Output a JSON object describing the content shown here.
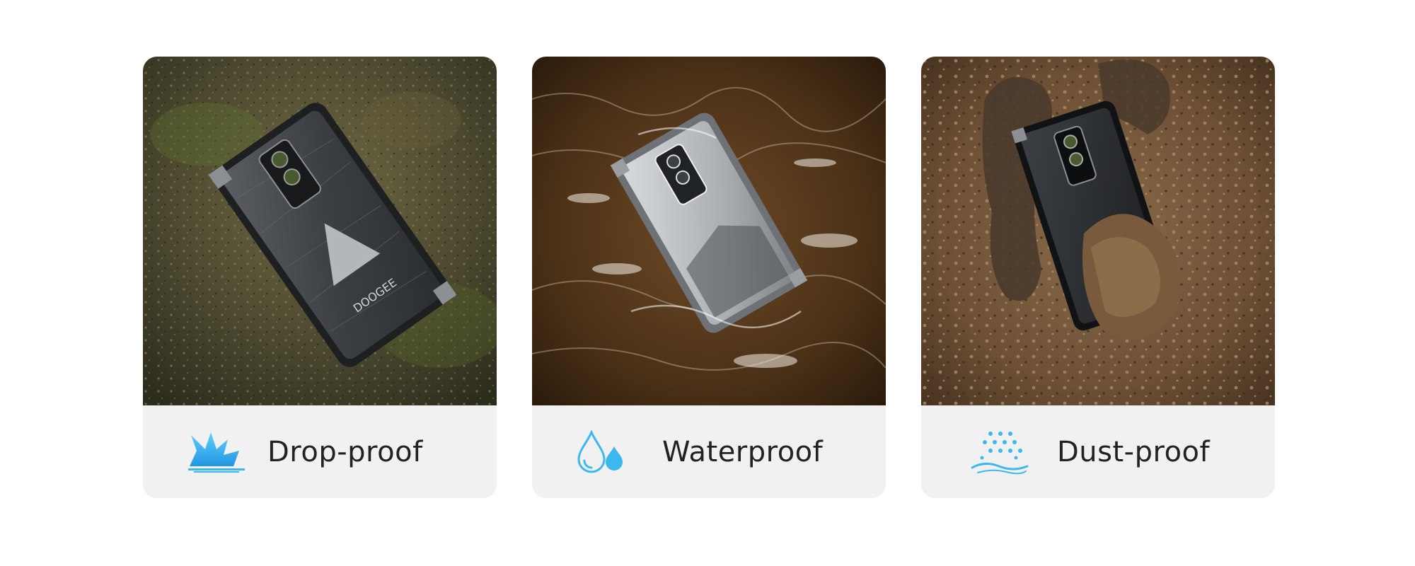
{
  "features": [
    {
      "id": "drop",
      "label": "Drop-proof",
      "icon": "drop-impact-icon"
    },
    {
      "id": "water",
      "label": "Waterproof",
      "icon": "water-drops-icon"
    },
    {
      "id": "dust",
      "label": "Dust-proof",
      "icon": "dust-particles-icon"
    }
  ],
  "phone_brand_text": "DOOGEE",
  "colors": {
    "card_background": "#f1f1f1",
    "icon_accent": "#3db8ee",
    "label_text": "#222222",
    "page_background": "#ffffff"
  }
}
